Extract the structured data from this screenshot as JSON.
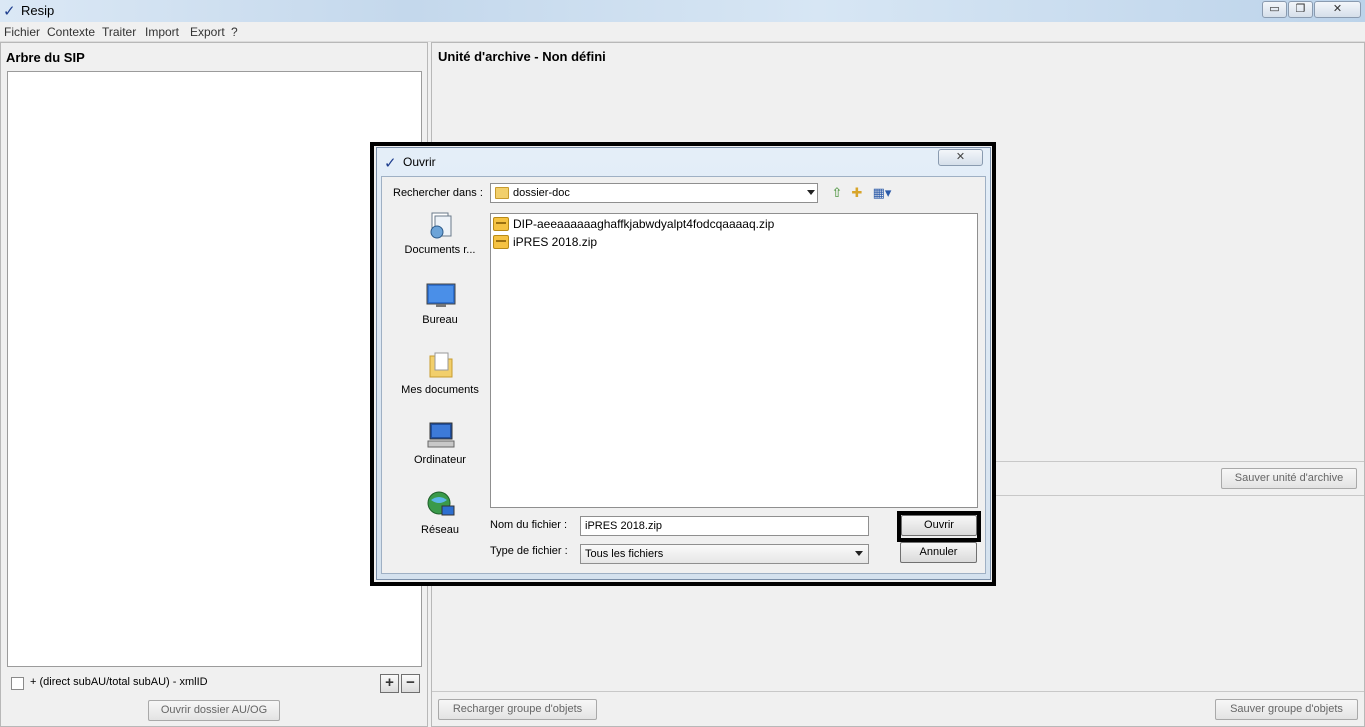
{
  "window": {
    "title": "Resip",
    "minimize": "▭",
    "maximize": "❐",
    "close": "✕"
  },
  "menu": [
    "Fichier",
    "Contexte",
    "Traiter",
    "Import",
    "Export",
    "?"
  ],
  "left_panel": {
    "title": "Arbre du SIP",
    "checkbox_label": "+ (direct subAU/total subAU) - xmlID",
    "add_symbol": "+",
    "remove_symbol": "−",
    "open_folder_button": "Ouvrir dossier AU/OG"
  },
  "right_panel": {
    "title": "Unité d'archive - Non défini",
    "save_au_button": "Sauver unité d'archive",
    "reload_button": "Recharger groupe d'objets",
    "save_og_button": "Sauver groupe d'objets"
  },
  "dialog": {
    "title": "Ouvrir",
    "close_symbol": "✕",
    "look_in_label": "Rechercher dans :",
    "look_in_value": "dossier-doc",
    "places": [
      {
        "label": "Documents r...",
        "icon": "recent-documents-icon"
      },
      {
        "label": "Bureau",
        "icon": "desktop-icon"
      },
      {
        "label": "Mes documents",
        "icon": "my-documents-icon"
      },
      {
        "label": "Ordinateur",
        "icon": "computer-icon"
      },
      {
        "label": "Réseau",
        "icon": "network-icon"
      }
    ],
    "files": [
      "DIP-aeeaaaaaaghaffkjabwdyalpt4fodcqaaaaq.zip",
      "iPRES 2018.zip"
    ],
    "filename_label": "Nom du fichier :",
    "filename_value": "iPRES 2018.zip",
    "filetype_label": "Type de fichier :",
    "filetype_value": "Tous les fichiers",
    "open_button": "Ouvrir",
    "cancel_button": "Annuler"
  }
}
